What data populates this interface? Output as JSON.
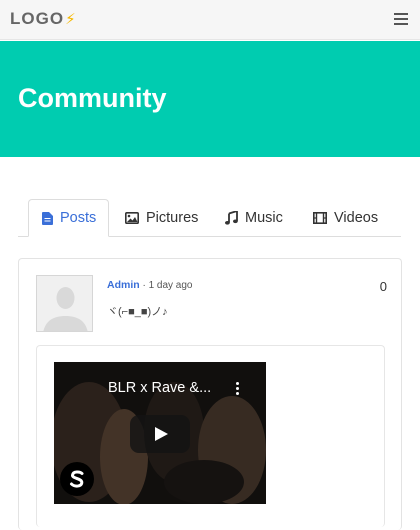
{
  "navbar": {
    "logo_text": "LOGO",
    "logo_mark": "⚡",
    "menu_icon": "hamburger-icon"
  },
  "hero": {
    "title": "Community",
    "background": "#00ccb0"
  },
  "tabs": [
    {
      "label": "Posts",
      "icon": "document-icon",
      "active": true
    },
    {
      "label": "Pictures",
      "icon": "image-icon",
      "active": false
    },
    {
      "label": "Music",
      "icon": "music-note-icon",
      "active": false
    },
    {
      "label": "Videos",
      "icon": "film-icon",
      "active": false
    }
  ],
  "post": {
    "author": "Admin",
    "separator": " · ",
    "time": "1 day ago",
    "text": "ヾ(⌐■_■)ノ♪",
    "count": "0",
    "video": {
      "title": "BLR x Rave &...",
      "channel_icon": "spinnin-logo-icon"
    }
  },
  "colors": {
    "accent": "#3a6fd8",
    "hero": "#00ccb0",
    "logo_mark": "#f5b800"
  }
}
